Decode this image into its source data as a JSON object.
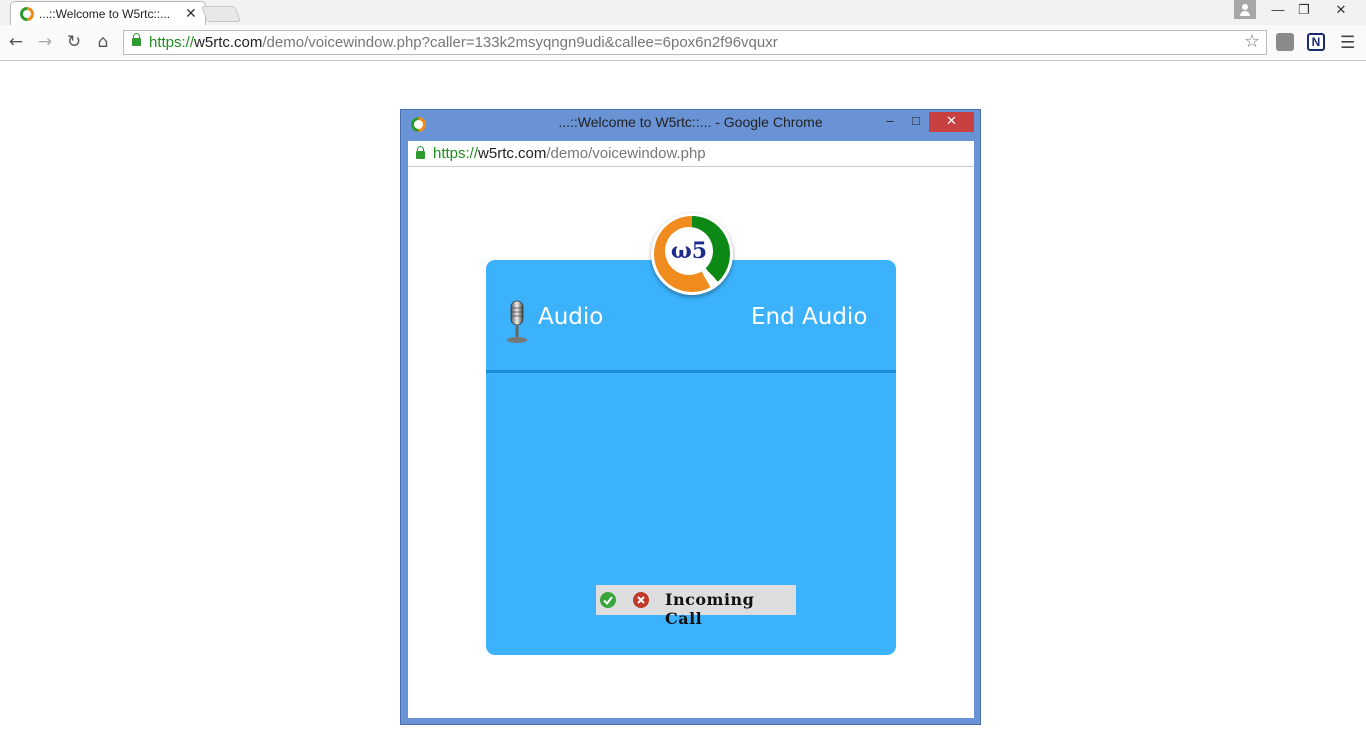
{
  "browser": {
    "tab_title": "...::Welcome to W5rtc::...",
    "tab_close": "✕",
    "window_min": "—",
    "window_restore": "❐",
    "window_close": "✕",
    "url_scheme": "https://",
    "url_host": "w5rtc.com",
    "url_path": "/demo/voicewindow.php?caller=133k2msyqngn9udi&callee=6pox6n2f96vquxr",
    "ext_label": "N"
  },
  "popup": {
    "title": "...::Welcome to W5rtc::... - Google Chrome",
    "min": "–",
    "max": "□",
    "close": "✕",
    "url_scheme": "https://",
    "url_host": "w5rtc.com",
    "url_path": "/demo/voicewindow.php"
  },
  "panel": {
    "logo_text": "ω5",
    "audio_label": "Audio",
    "end_audio_label": "End Audio",
    "call_status": "Incoming Call"
  },
  "colors": {
    "panel_bg": "#3bb2fb",
    "popup_frame": "#6a93d6",
    "accept": "#3aa53a",
    "reject": "#c0392b"
  }
}
